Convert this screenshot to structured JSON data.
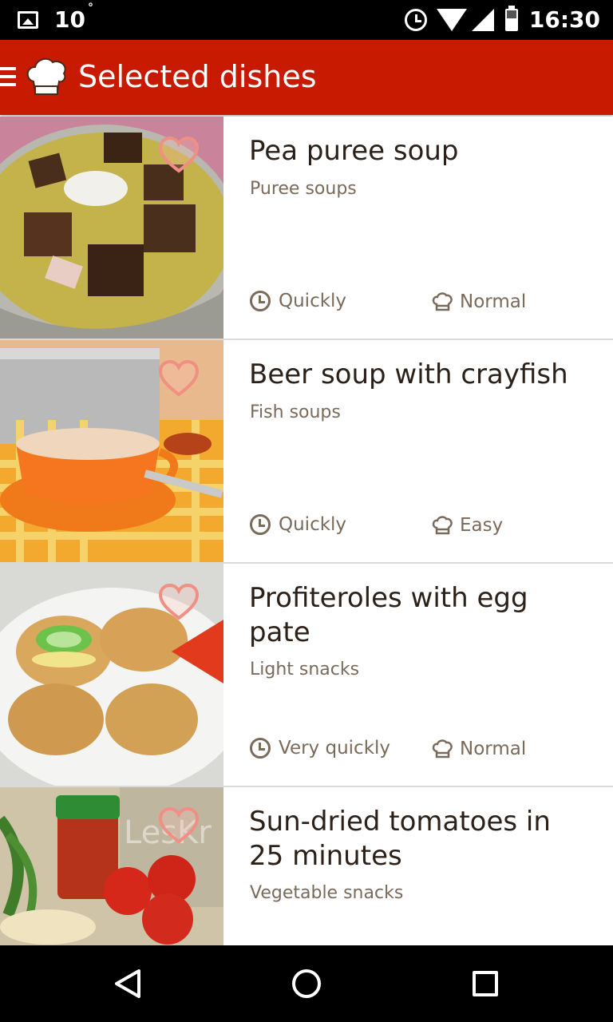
{
  "status_bar": {
    "notification_count": "10",
    "notification_extra": "°",
    "time": "16:30",
    "icons": [
      "image-icon",
      "alarm-icon",
      "wifi-icon",
      "signal-icon",
      "battery-icon"
    ]
  },
  "app_bar": {
    "title": "Selected dishes",
    "accent_color": "#c71a00",
    "icons": [
      "menu-icon",
      "chef-hat-logo"
    ]
  },
  "dishes": [
    {
      "title": "Pea puree soup",
      "category": "Puree soups",
      "time": "Quickly",
      "difficulty": "Normal",
      "favorite": true
    },
    {
      "title": "Beer soup with crayfish",
      "category": "Fish soups",
      "time": "Quickly",
      "difficulty": "Easy",
      "favorite": true
    },
    {
      "title": "Profiteroles with egg pate",
      "category": "Light snacks",
      "time": "Very quickly",
      "difficulty": "Normal",
      "favorite": true
    },
    {
      "title": "Sun-dried tomatoes in 25 minutes",
      "category": "Vegetable snacks",
      "time": "",
      "difficulty": "",
      "favorite": true
    }
  ],
  "nav_bar": {
    "icons": [
      "back-icon",
      "home-icon",
      "recents-icon"
    ]
  }
}
